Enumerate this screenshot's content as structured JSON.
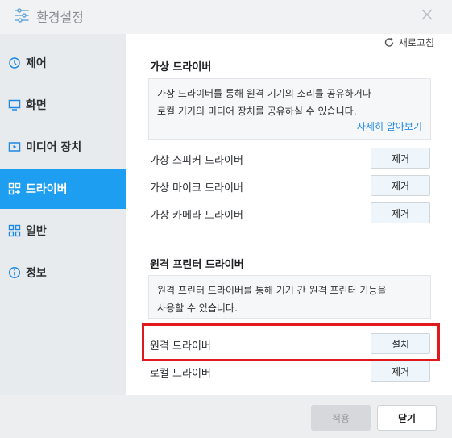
{
  "window": {
    "title": "환경설정",
    "icon": "sliders-icon",
    "close_icon": "close-icon"
  },
  "sidebar": {
    "items": [
      {
        "label": "제어",
        "icon": "clock-icon",
        "active": false
      },
      {
        "label": "화면",
        "icon": "monitor-icon",
        "active": false
      },
      {
        "label": "미디어 장치",
        "icon": "media-device-icon",
        "active": false
      },
      {
        "label": "드라이버",
        "icon": "driver-icon",
        "active": true
      },
      {
        "label": "일반",
        "icon": "grid-icon",
        "active": false
      },
      {
        "label": "정보",
        "icon": "info-icon",
        "active": false
      }
    ]
  },
  "main": {
    "refresh_label": "새로고침",
    "virtual": {
      "title": "가상 드라이버",
      "description_line1": "가상 드라이버를 통해 원격 기기의 소리를 공유하거나",
      "description_line2": "로컬 기기의 미디어 장치를 공유하실 수 있습니다.",
      "learn_more": "자세히 알아보기",
      "rows": [
        {
          "label": "가상 스피커 드라이버",
          "button": "제거"
        },
        {
          "label": "가상 마이크 드라이버",
          "button": "제거"
        },
        {
          "label": "가상 카메라 드라이버",
          "button": "제거"
        }
      ]
    },
    "printer": {
      "title": "원격 프린터 드라이버",
      "description_line1": "원격 프린터 드라이버를 통해 기기 간 원격 프린터 기능을",
      "description_line2": "사용할 수 있습니다.",
      "rows": [
        {
          "label": "원격 드라이버",
          "button": "설치"
        },
        {
          "label": "로컬 드라이버",
          "button": "제거"
        }
      ]
    }
  },
  "footer": {
    "apply_label": "적용",
    "close_label": "닫기"
  },
  "colors": {
    "accent": "#1e9ef0",
    "highlight": "#e0191e",
    "link": "#1e88e5"
  }
}
